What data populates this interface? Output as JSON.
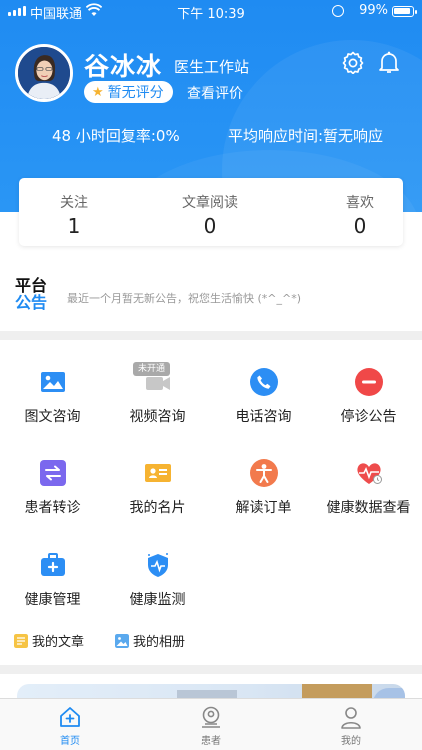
{
  "status_bar": {
    "carrier": "中国联通",
    "time": "下午 10:39",
    "battery": "99%"
  },
  "doctor": {
    "name": "谷冰冰",
    "station": "医生工作站",
    "rating": "暂无评分",
    "view_reviews": "查看评价"
  },
  "stats": {
    "reply_rate": "48 小时回复率:0%",
    "response_time": "平均响应时间:暂无响应"
  },
  "counters": [
    {
      "label": "关注",
      "value": "1"
    },
    {
      "label": "文章阅读",
      "value": "0"
    },
    {
      "label": "喜欢",
      "value": "0"
    }
  ],
  "notice": {
    "logo_line1": "平台",
    "logo_line2": "公告",
    "text": "最近一个月暂无新公告，祝您生活愉快 (*^_^*)"
  },
  "services": [
    {
      "label": "图文咨询",
      "icon": "image-icon",
      "color": "#2c8ef4"
    },
    {
      "label": "视频咨询",
      "icon": "video-icon",
      "color": "#a9a9a9",
      "badge": "未开通"
    },
    {
      "label": "电话咨询",
      "icon": "phone-icon",
      "color": "#2c8ef4"
    },
    {
      "label": "停诊公告",
      "icon": "stop-icon",
      "color": "#f04848"
    },
    {
      "label": "患者转诊",
      "icon": "transfer-icon",
      "color": "#7b68ee"
    },
    {
      "label": "我的名片",
      "icon": "card-icon",
      "color": "#f6b331"
    },
    {
      "label": "解读订单",
      "icon": "person-icon",
      "color": "#f27a4d"
    },
    {
      "label": "健康数据查看",
      "icon": "heart-data-icon",
      "color": "#ee4c4c"
    },
    {
      "label": "健康管理",
      "icon": "medkit-icon",
      "color": "#2c8ef4"
    },
    {
      "label": "健康监测",
      "icon": "shield-icon",
      "color": "#2c8ef4"
    }
  ],
  "quick_links": [
    {
      "label": "我的文章",
      "icon": "article-icon",
      "color": "#f6c445"
    },
    {
      "label": "我的相册",
      "icon": "album-icon",
      "color": "#5aa9ee"
    }
  ],
  "tabs": [
    {
      "label": "首页",
      "active": true
    },
    {
      "label": "患者",
      "active": false
    },
    {
      "label": "我的",
      "active": false
    }
  ],
  "colors": {
    "primary": "#1f8bf2",
    "star": "#f6b331"
  }
}
